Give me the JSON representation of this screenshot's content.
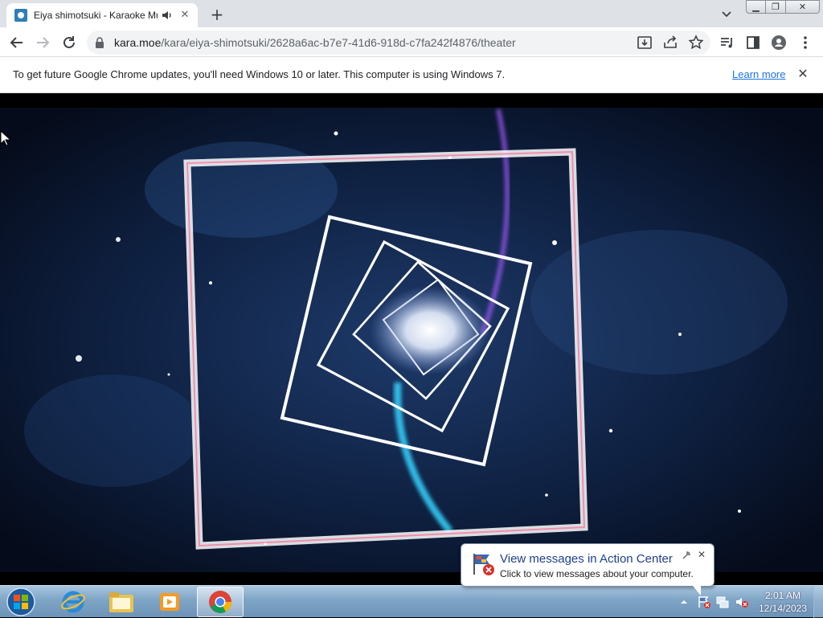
{
  "browser": {
    "tab": {
      "title": "Eiya shimotsuki - Karaoke Mugen",
      "favicon": "kara-favicon-icon",
      "audio_icon": "speaker-icon"
    },
    "new_tab_icon": "plus-icon",
    "window_controls": {
      "minimize": "minimize-icon",
      "maximize": "restore-icon",
      "close": "close-icon"
    }
  },
  "toolbar": {
    "url_host": "kara.moe",
    "url_path": "/kara/eiya-shimotsuki/2628a6ac-b7e7-41d6-918d-c7fa242f4876/theater"
  },
  "infobar": {
    "message": "To get future Google Chrome updates, you'll need Windows 10 or later. This computer is using Windows 7.",
    "link": "Learn more"
  },
  "balloon": {
    "title": "View messages in Action Center",
    "subtitle": "Click to view messages about your computer."
  },
  "clock": {
    "time": "2:01 AM",
    "date": "12/14/2023"
  },
  "colors": {
    "accent": "#1a73e8",
    "taskbar": "#7ea4c6",
    "balloon_title": "#1e3f8f"
  }
}
